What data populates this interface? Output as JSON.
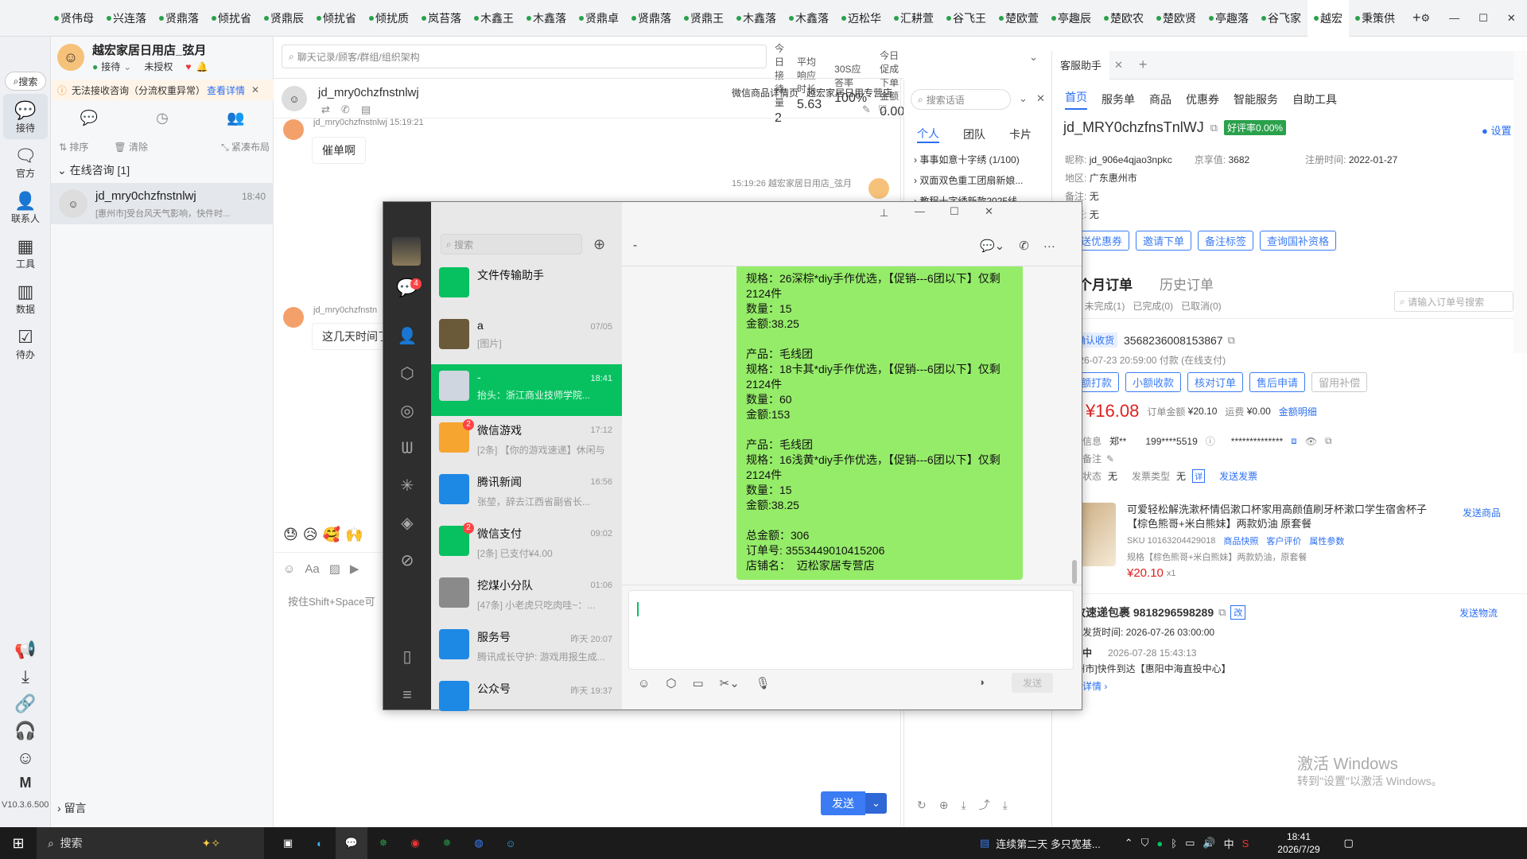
{
  "tabs": [
    "贤伟母",
    "兴连落",
    "贤鼎落",
    "倾扰省",
    "贤鼎辰",
    "倾扰省",
    "倾扰质",
    "岚苔落",
    "木鑫王",
    "木鑫落",
    "贤鼎卓",
    "贤鼎落",
    "贤鼎王",
    "木鑫落",
    "木鑫落",
    "迈松华",
    "汇耕萱",
    "谷飞王",
    "楚欧萱",
    "亭趣辰",
    "楚欧农",
    "楚欧贤",
    "亭趣落",
    "谷飞家",
    "越宏",
    "秉策供"
  ],
  "leftnav": {
    "search": "搜索",
    "items": [
      "接待",
      "官方",
      "联系人",
      "工具",
      "数据",
      "待办"
    ],
    "version": "V10.3.6.500"
  },
  "store": {
    "name": "越宏家居日用店_弦月",
    "status": "接待",
    "auth": "未授权"
  },
  "warn": {
    "text": "无法接收咨询（分流权重异常）",
    "link": "查看详情"
  },
  "listbar": {
    "sort": "排序",
    "clear": "清除",
    "layout": "紧凑布局"
  },
  "consult": {
    "title": "在线咨询 [1]",
    "item_name": "jd_mry0chzfnstnlwj",
    "item_time": "18:40",
    "item_preview": "[惠州市]受台风天气影响，快件时..."
  },
  "leave": "留言",
  "search_placeholder": "聊天记录/顾客/群组/组织架构",
  "stats": [
    {
      "label": "今日接待量",
      "value": "2"
    },
    {
      "label": "平均响应时长",
      "value": "5.63"
    },
    {
      "label": "30S应答率",
      "value": "100%"
    },
    {
      "label": "今日促成下单金额",
      "value": "0.00"
    }
  ],
  "chat": {
    "name": "jd_mry0chzfnstnlwj",
    "links": [
      "微信商品详情页",
      "越宏家居日用专营店"
    ],
    "msg1_name": "jd_mry0chzfnstnlwj  15:19:21",
    "msg1": "催单啊",
    "agent_time": "15:19:26  越宏家居日用店_弦月",
    "msg2_name": "jd_mry0chzfnstn",
    "msg2": "这几天时间了",
    "input_hint": "按住Shift+Space可",
    "send": "发送",
    "emojis": "😓😥🥰🙌"
  },
  "quick": {
    "search": "搜索话语",
    "tabs": [
      "个人",
      "团队",
      "卡片"
    ],
    "items": [
      "事事如意十字绣 (1/100)",
      "双面双色重工团扇新娘...",
      "教程十字绣新款2025线..."
    ]
  },
  "wechat": {
    "search": "搜索",
    "chat_title": "-",
    "chats": [
      {
        "name": "文件传输助手",
        "preview": "",
        "time": ""
      },
      {
        "name": "a",
        "preview": "[图片]",
        "time": "07/05"
      },
      {
        "name": "-",
        "preview": "抬头：浙江商业技师学院...",
        "time": "18:41"
      },
      {
        "name": "微信游戏",
        "preview": "[2条] 【你的游戏速递】休闲与培...",
        "time": "17:12"
      },
      {
        "name": "腾讯新闻",
        "preview": "张堃，辞去江西省副省长...",
        "time": "16:56"
      },
      {
        "name": "微信支付",
        "preview": "[2条] 已支付¥4.00",
        "time": "09:02"
      },
      {
        "name": "挖煤小分队",
        "preview": "[47条] 小老虎只吃肉哇~：...",
        "time": "01:06"
      },
      {
        "name": "服务号",
        "preview": "腾讯成长守护: 游戏用报生成...",
        "time": "昨天 20:07"
      },
      {
        "name": "公众号",
        "preview": "",
        "time": "昨天 19:37"
      }
    ],
    "badges": {
      "chats": "4",
      "games": "2",
      "pay": "2"
    },
    "message": "规格：26深棕*diy手作优选，【促销---6团以下】仅剩2124件\n数量：15\n金额:38.25\n\n产品：毛线团\n规格：18卡其*diy手作优选，【促销---6团以下】仅剩2124件\n数量：60\n金额:153\n\n产品：毛线团\n规格：16浅黄*diy手作优选，【促销---6团以下】仅剩2124件\n数量：15\n金额:38.25\n\n总金额：306\n订单号: 3553449010415206\n店铺名：  迈松家居专营店",
    "send": "发送"
  },
  "assistant": {
    "tab": "客服助手",
    "nav": [
      "首页",
      "服务单",
      "商品",
      "优惠券",
      "智能服务",
      "自助工具"
    ],
    "user": "jd_MRY0chzfnsTnlWJ",
    "rate": "好评率0.00%",
    "settings": "设置",
    "nick_label": "昵称:",
    "nick": "jd_906e4qjao3npkc",
    "jx_label": "京享值:",
    "jx": "3682",
    "reg_label": "注册时间:",
    "reg": "2022-01-27",
    "area_label": "地区:",
    "area": "广东惠州市",
    "remark_label": "备注:",
    "remark": "无",
    "tag_label": "标签:",
    "tag": "无",
    "btns": [
      "发送优惠券",
      "邀请下单",
      "备注标签",
      "查询国补资格"
    ],
    "order_tabs": [
      "三个月订单",
      "历史订单"
    ],
    "filters": [
      "(1)",
      "未完成(1)",
      "已完成(0)",
      "已取消(0)"
    ],
    "order_search": "请输入订单号搜索",
    "order_status": "待确认收货",
    "order_no": "3568236008153867",
    "order_time": "2026-07-23 20:59:00 付款 (在线支付)",
    "order_btns": [
      "小额打款",
      "小额收款",
      "核对订单",
      "售后申请",
      "留用补偿"
    ],
    "pay_label": "实付",
    "pay": "¥16.08",
    "amt_label": "订单金额",
    "amt": "¥20.10",
    "ship_label": "运费",
    "ship": "¥0.00",
    "detail": "金额明细",
    "info_label": "收货信息",
    "info_name": "郑**",
    "info_phone": "199****5519",
    "info_addr": "**************",
    "note_label": "卖家备注",
    "invoice_label": "发票状态",
    "invoice": "无",
    "invoice_type_label": "发票类型",
    "invoice_type": "无",
    "invoice_send": "发送发票",
    "product_title": "可爱轻松解洗漱杯情侣漱口杯家用高颜值刷牙杯漱口学生宿舍杯子【棕色熊哥+米白熊妹】两款奶油 原套餐",
    "send_product": "发送商品",
    "sku": "SKU 10163204429018",
    "sku_links": [
      "商品快照",
      "客户评价",
      "属性参数"
    ],
    "spec": "规格【棕色熊哥+米白熊妹】两款奶油，原套餐",
    "price": "¥20.10",
    "qty": "x1",
    "ship_title": "邮政速递包裹 9818296598289",
    "ship_edit": "改",
    "ship_send": "发送物流",
    "ship_latest": "最晚发货时间: 2026-07-26 03:00:00",
    "ship_status": "运输中",
    "ship_status_time": "2026-07-28 15:43:13",
    "ship_detail": "[惠州市]快件到达【惠阳中海直投中心】",
    "ship_more": "物流详情 ›",
    "activate1": "激活 Windows",
    "activate2": "转到\"设置\"以激活 Windows。"
  },
  "taskbar": {
    "search": "搜索",
    "news": "连续第二天 多只宽基...",
    "ime": "中",
    "time": "18:41",
    "date": "2026/7/29"
  }
}
